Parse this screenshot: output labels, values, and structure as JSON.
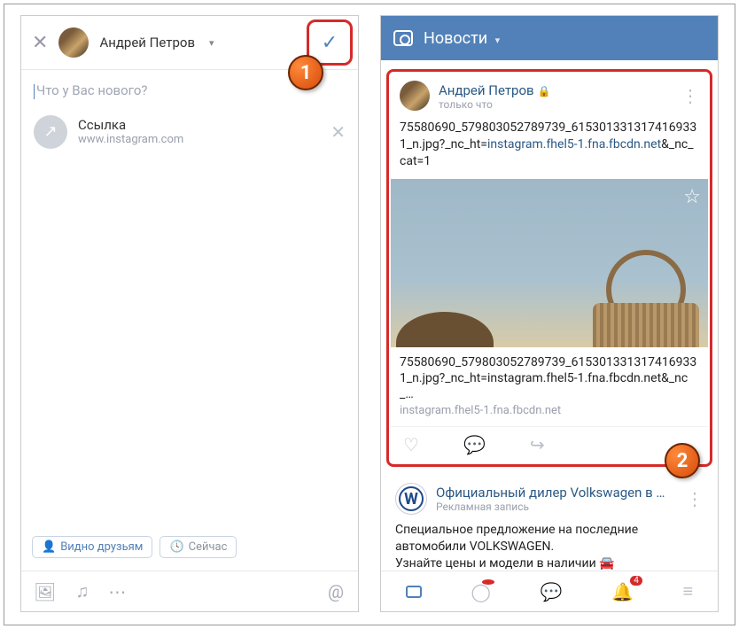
{
  "callouts": {
    "one": "1",
    "two": "2"
  },
  "left": {
    "author": "Андрей Петров",
    "placeholder": "Что у Вас нового?",
    "link": {
      "title": "Ссылка",
      "domain": "www.instagram.com"
    },
    "visibility": "Видно друзьям",
    "schedule": "Сейчас"
  },
  "right": {
    "header": "Новости",
    "post": {
      "author": "Андрей Петров",
      "time": "только что",
      "text_pre": "75580690_579803052789739_6153013313174169331_n.jpg?_nc_ht=",
      "text_url": "instagram.fhel5-1.fna.fbcdn.net",
      "text_post": "&_nc_cat=1",
      "link_title": "75580690_579803052789739_6153013313174169331_n.jpg?_nc_ht=instagram.fhel5-1.fna.fbcdn.net&_nc_…",
      "link_domain": "instagram.fhel5-1.fna.fbcdn.net"
    },
    "ad": {
      "title": "Официальный дилер Volkswagen в Са…",
      "sub": "Рекламная запись",
      "text1": "Специальное предложение на последние автомобили VOLKSWAGEN.",
      "text2": "Узнайте цены и модели в наличии 🚘"
    },
    "badge": "4"
  }
}
